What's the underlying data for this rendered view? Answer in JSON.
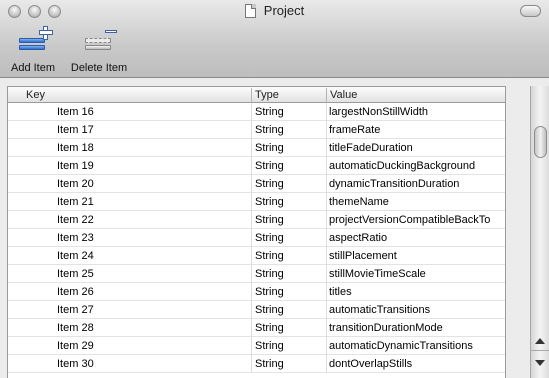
{
  "window": {
    "title": "Project"
  },
  "toolbar": {
    "add_label": "Add Item",
    "delete_label": "Delete Item"
  },
  "table": {
    "columns": [
      "Key",
      "Type",
      "Value"
    ],
    "rows": [
      {
        "key": "Item 16",
        "type": "String",
        "value": "largestNonStillWidth"
      },
      {
        "key": "Item 17",
        "type": "String",
        "value": "frameRate"
      },
      {
        "key": "Item 18",
        "type": "String",
        "value": "titleFadeDuration"
      },
      {
        "key": "Item 19",
        "type": "String",
        "value": "automaticDuckingBackground"
      },
      {
        "key": "Item 20",
        "type": "String",
        "value": "dynamicTransitionDuration"
      },
      {
        "key": "Item 21",
        "type": "String",
        "value": "themeName"
      },
      {
        "key": "Item 22",
        "type": "String",
        "value": "projectVersionCompatibleBackTo"
      },
      {
        "key": "Item 23",
        "type": "String",
        "value": "aspectRatio"
      },
      {
        "key": "Item 24",
        "type": "String",
        "value": "stillPlacement"
      },
      {
        "key": "Item 25",
        "type": "String",
        "value": "stillMovieTimeScale"
      },
      {
        "key": "Item 26",
        "type": "String",
        "value": "titles"
      },
      {
        "key": "Item 27",
        "type": "String",
        "value": "automaticTransitions"
      },
      {
        "key": "Item 28",
        "type": "String",
        "value": "transitionDurationMode"
      },
      {
        "key": "Item 29",
        "type": "String",
        "value": "automaticDynamicTransitions"
      },
      {
        "key": "Item 30",
        "type": "String",
        "value": "dontOverlapStills"
      }
    ]
  }
}
